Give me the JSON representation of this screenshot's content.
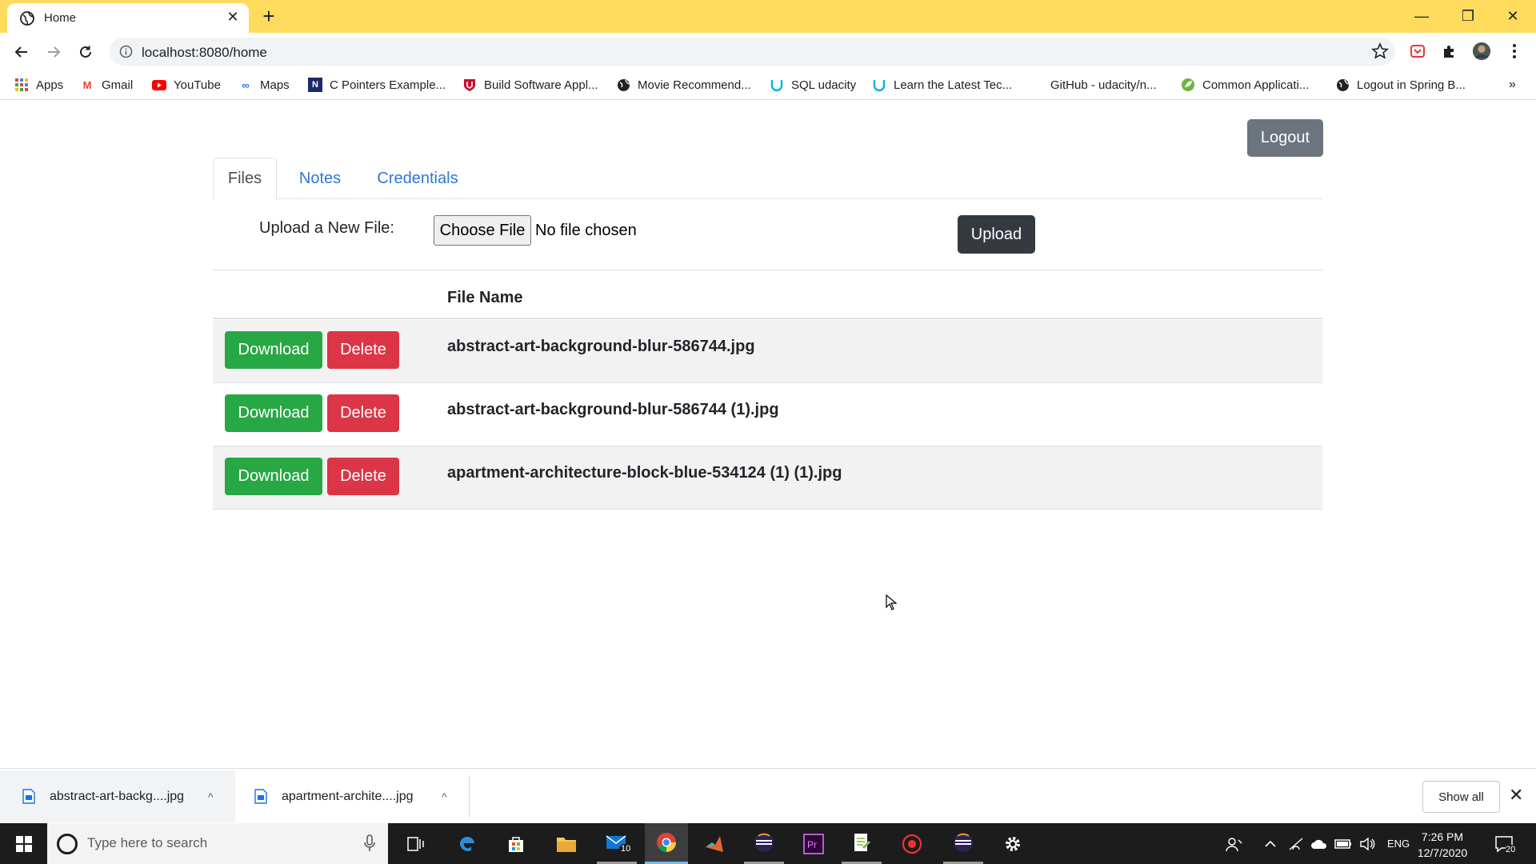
{
  "browser": {
    "tab_title": "Home",
    "new_tab_symbol": "+",
    "close_tab_symbol": "✕",
    "url": "localhost:8080/home",
    "minimize": "—",
    "restore": "❐",
    "close": "✕"
  },
  "bookmarks": [
    {
      "label": "Apps",
      "icon": "apps-grid-icon"
    },
    {
      "label": "Gmail",
      "icon": "gmail-icon"
    },
    {
      "label": "YouTube",
      "icon": "youtube-icon"
    },
    {
      "label": "Maps",
      "icon": "maps-icon"
    },
    {
      "label": "C Pointers Example...",
      "icon": "c-pointers-icon"
    },
    {
      "label": "Build Software Appl...",
      "icon": "shield-icon"
    },
    {
      "label": "Movie Recommend...",
      "icon": "globe-icon"
    },
    {
      "label": "SQL udacity",
      "icon": "udacity-icon"
    },
    {
      "label": "Learn the Latest Tec...",
      "icon": "udacity-icon"
    },
    {
      "label": "GitHub - udacity/n...",
      "icon": "github-icon"
    },
    {
      "label": "Common Applicati...",
      "icon": "spring-icon"
    },
    {
      "label": "Logout in Spring B...",
      "icon": "globe-icon"
    }
  ],
  "bookmarks_overflow": "»",
  "page": {
    "logout_label": "Logout",
    "tabs": [
      "Files",
      "Notes",
      "Credentials"
    ],
    "upload_label": "Upload a New File:",
    "choose_file_label": "Choose File",
    "no_file_text": "No file chosen",
    "upload_button": "Upload",
    "column_header": "File Name",
    "download_label": "Download",
    "delete_label": "Delete",
    "files": [
      "abstract-art-background-blur-586744.jpg",
      "abstract-art-background-blur-586744 (1).jpg",
      "apartment-architecture-block-blue-534124 (1) (1).jpg"
    ]
  },
  "downloads": {
    "items": [
      "abstract-art-backg....jpg",
      "apartment-archite....jpg"
    ],
    "chevron": "^",
    "show_all": "Show all",
    "close": "✕"
  },
  "taskbar": {
    "search_placeholder": "Type here to search",
    "mail_badge": "10",
    "language": "ENG",
    "time": "7:26 PM",
    "date": "12/7/2020",
    "notification_count": "20"
  },
  "colors": {
    "chrome_frame": "#fedb5d",
    "link_blue": "#2e78d6",
    "download_green": "#28a745",
    "delete_red": "#dc3545",
    "upload_dark": "#343a40",
    "logout_gray": "#6c757d"
  }
}
